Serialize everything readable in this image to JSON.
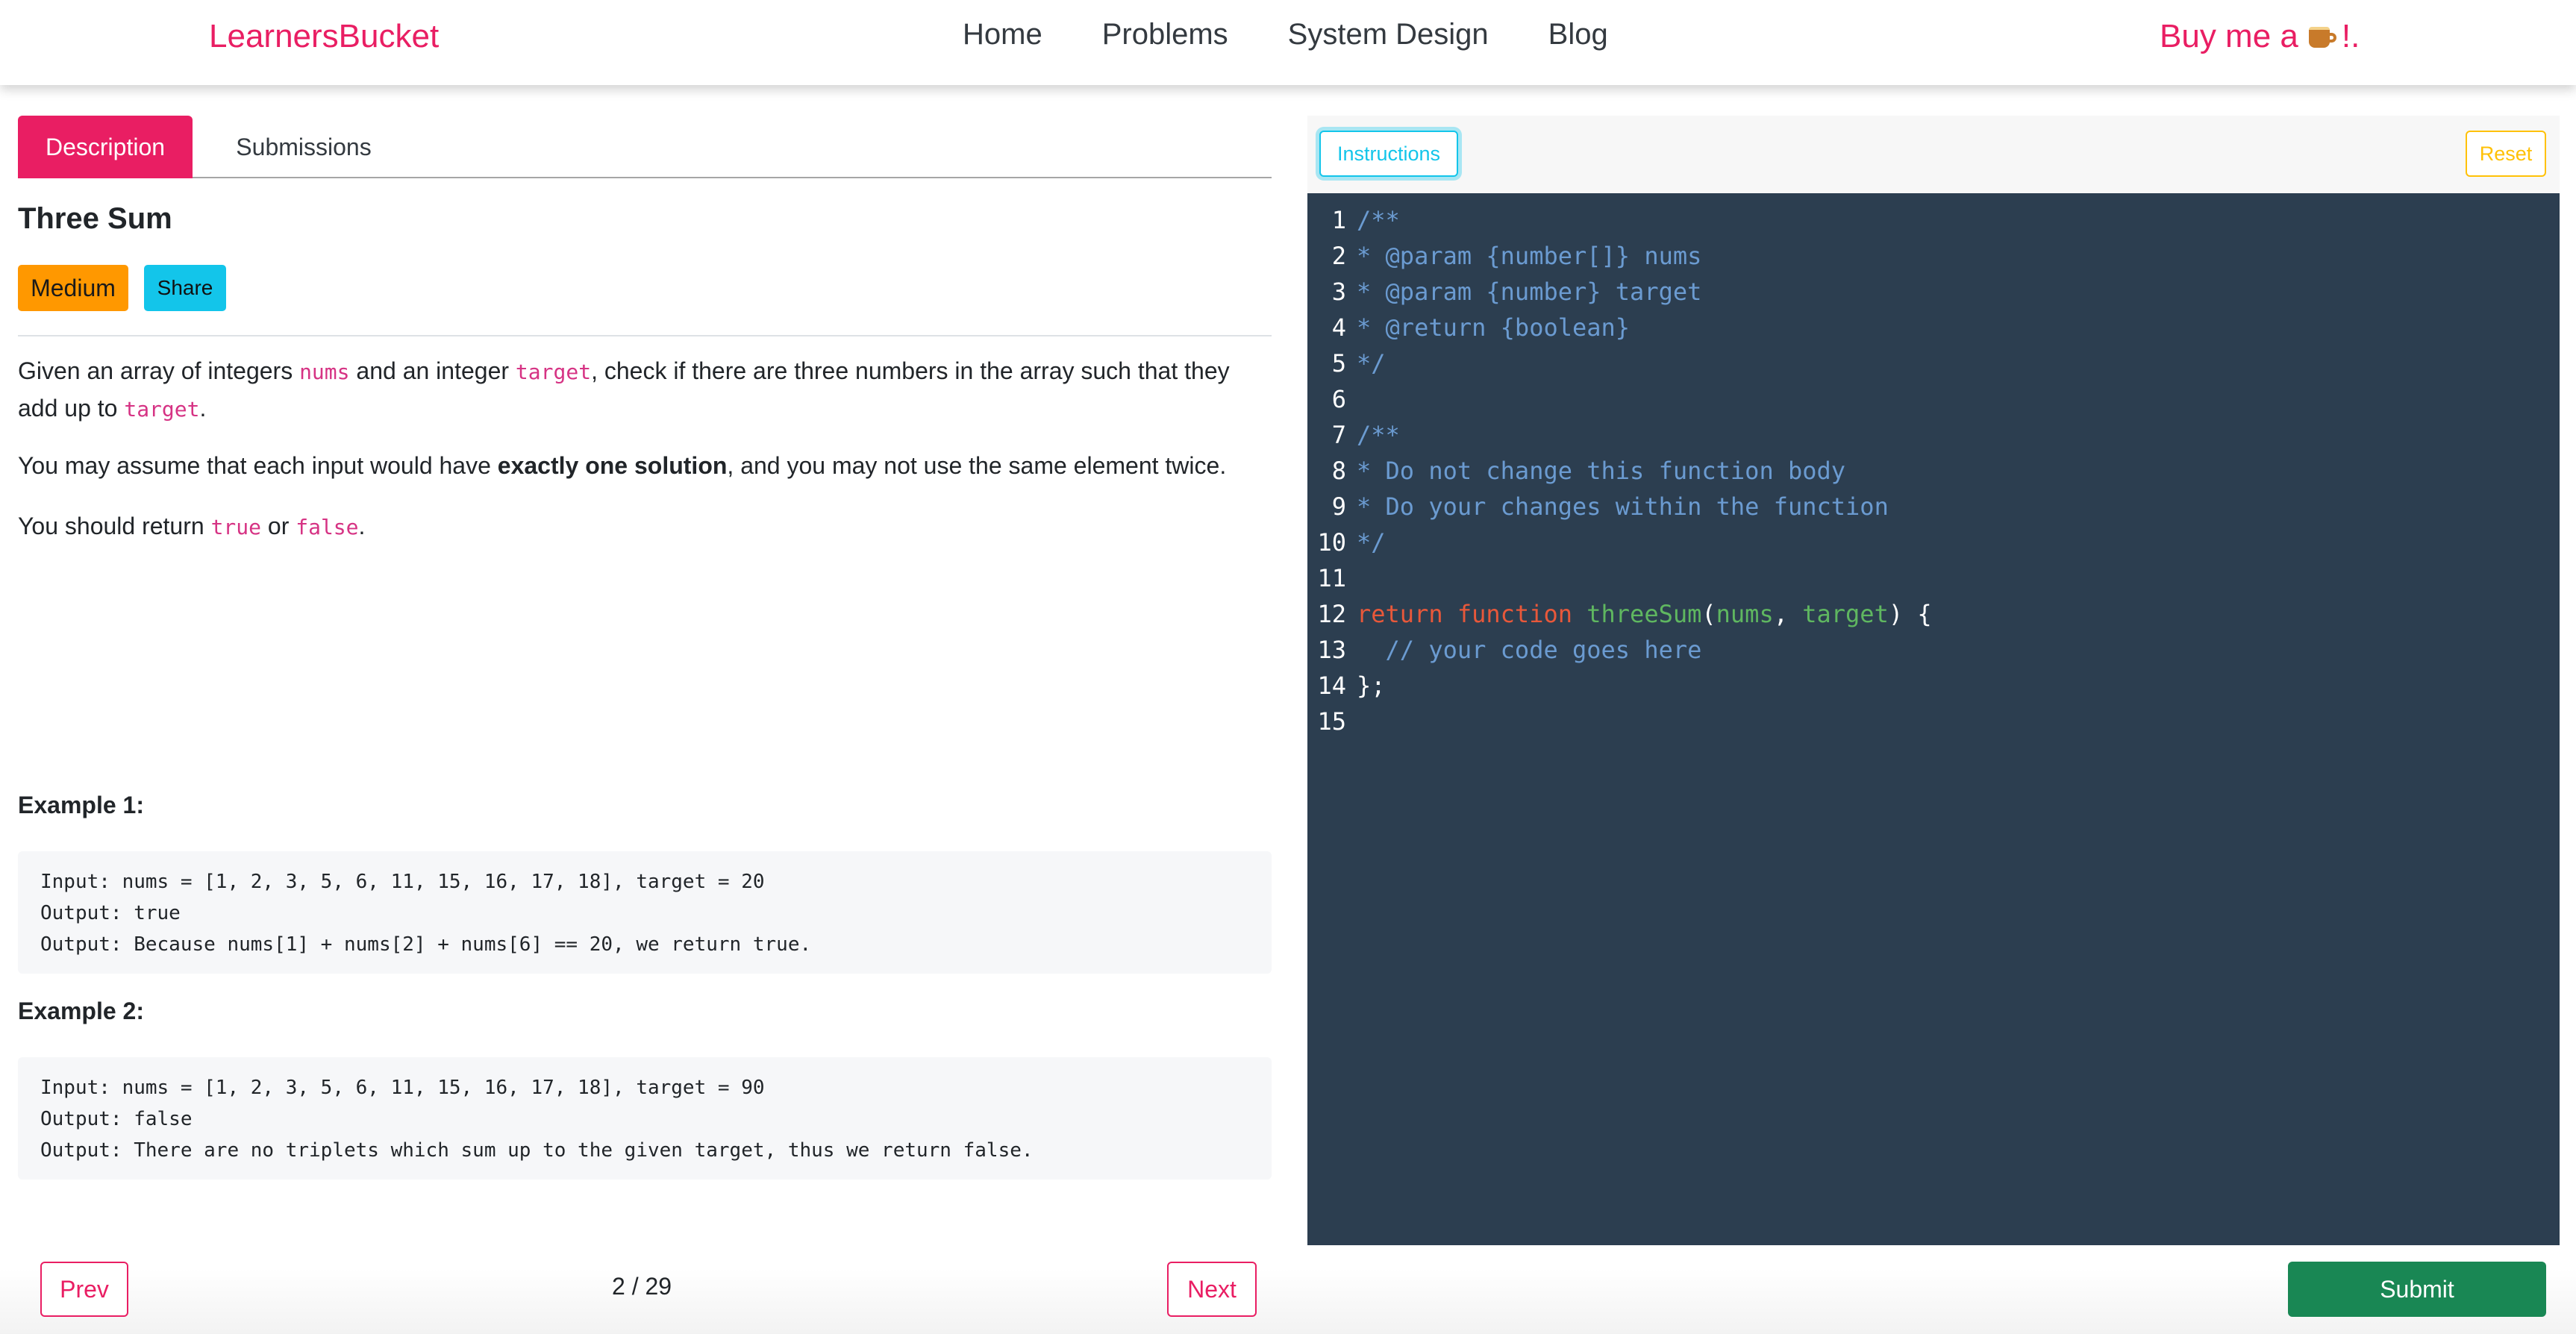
{
  "navbar": {
    "brand": "LearnersBucket",
    "links": [
      "Home",
      "Problems",
      "System Design",
      "Blog"
    ],
    "coffee_prefix": "Buy me a",
    "coffee_icon": "coffee-cup-icon",
    "coffee_suffix": "!."
  },
  "tabs": [
    "Description",
    "Submissions"
  ],
  "problem": {
    "title": "Three Sum",
    "difficulty": "Medium",
    "share_label": "Share",
    "p1": {
      "t1": "Given an array of integers ",
      "c1": "nums",
      "t2": " and an integer ",
      "c2": "target",
      "t3": ", check if there are three numbers in the array such that they add up to ",
      "c3": "target",
      "t4": "."
    },
    "p2": {
      "t1": "You may assume that each input would have ",
      "bold": "exactly one solution",
      "t2": ", and you may not use the same element twice."
    },
    "p3": {
      "t1": "You should return ",
      "c1": "true",
      "t2": " or ",
      "c2": "false",
      "t3": "."
    },
    "examples": [
      {
        "heading": "Example 1:",
        "lines": [
          "Input: nums = [1, 2, 3, 5, 6, 11, 15, 16, 17, 18], target = 20",
          "Output: true",
          "Output: Because nums[1] + nums[2] + nums[6] == 20, we return true."
        ]
      },
      {
        "heading": "Example 2:",
        "lines": [
          "Input: nums = [1, 2, 3, 5, 6, 11, 15, 16, 17, 18], target = 90",
          "Output: false",
          "Output: There are no triplets which sum up to the given target, thus we return false."
        ]
      }
    ]
  },
  "pagination": {
    "prev_label": "Prev",
    "next_label": "Next",
    "current": "2 / 29"
  },
  "editor": {
    "instructions_label": "Instructions",
    "reset_label": "Reset",
    "submit_label": "Submit",
    "lines": [
      {
        "n": "1",
        "a": "/**"
      },
      {
        "n": "2",
        "a": "* @param {number[]} nums"
      },
      {
        "n": "3",
        "a": "* @param {number} target"
      },
      {
        "n": "4",
        "a": "* @return {boolean}"
      },
      {
        "n": "5",
        "a": "*/"
      },
      {
        "n": "6",
        "a": ""
      },
      {
        "n": "7",
        "a": "/**"
      },
      {
        "n": "8",
        "a": "* Do not change this function body"
      },
      {
        "n": "9",
        "a": "* Do your changes within the function"
      },
      {
        "n": "10",
        "a": "*/"
      },
      {
        "n": "11",
        "a": ""
      },
      {
        "n": "12",
        "kw1": "return",
        "kw2": "function",
        "fn": "threeSum",
        "p1": "(",
        "arg1": "nums",
        "p2": ", ",
        "arg2": "target",
        "p3": ") {"
      },
      {
        "n": "13",
        "a": "  // your code goes here"
      },
      {
        "n": "14",
        "b": "};"
      },
      {
        "n": "15",
        "a": ""
      }
    ]
  },
  "colors": {
    "accent": "#e91e63",
    "medium": "#ff9800",
    "info": "#13c5ea",
    "warning": "#ffc107",
    "success": "#198754",
    "editor_bg": "#2c3e50"
  }
}
